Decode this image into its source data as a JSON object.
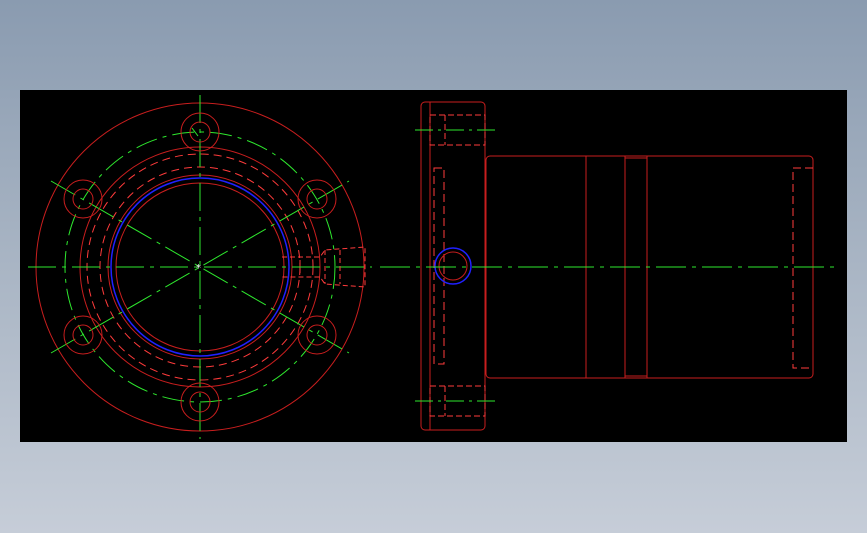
{
  "viewport": {
    "background": "#000000"
  },
  "colors": {
    "outline": "#c81e1e",
    "hidden": "#ff3b3b",
    "centerline": "#2ee82e",
    "highlight": "#2020ff",
    "page_top": "#8a9bb0",
    "page_bottom": "#c6cdd8"
  },
  "views": [
    {
      "name": "front-view",
      "bolt_holes": 6
    },
    {
      "name": "side-view"
    }
  ]
}
